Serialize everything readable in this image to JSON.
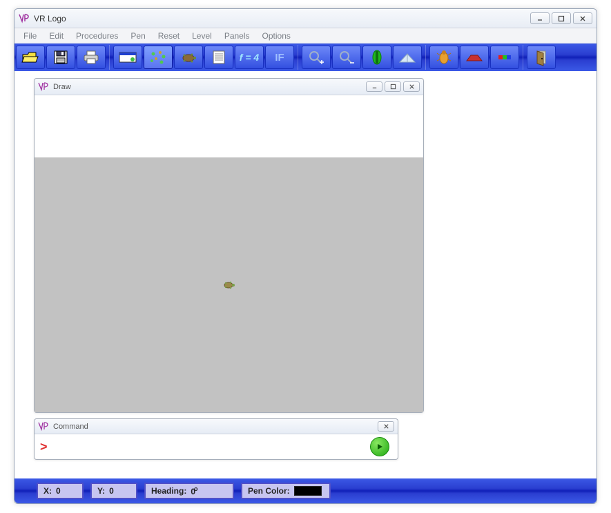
{
  "window": {
    "title": "VR Logo",
    "controls": {
      "min": "min",
      "max": "max",
      "close": "close"
    }
  },
  "menu": [
    "File",
    "Edit",
    "Procedures",
    "Pen",
    "Reset",
    "Level",
    "Panels",
    "Options"
  ],
  "toolbar": {
    "groups": [
      [
        "open",
        "save",
        "print"
      ],
      [
        "panel-blue",
        "panel-dots",
        "panel-turtle",
        "list",
        "var",
        "if"
      ],
      [
        "zoom-in",
        "zoom-out",
        "stoplight",
        "perspective"
      ],
      [
        "turtle-shape",
        "roof",
        "colors"
      ],
      [
        "exit"
      ]
    ],
    "var_label": "f = 4",
    "if_label": "IF"
  },
  "draw": {
    "title": "Draw"
  },
  "command": {
    "title": "Command",
    "prompt": ">",
    "value": ""
  },
  "status": {
    "x": {
      "label": "X:",
      "value": "0"
    },
    "y": {
      "label": "Y:",
      "value": "0"
    },
    "heading": {
      "label": "Heading:",
      "value": "0"
    },
    "pen": {
      "label": "Pen Color:",
      "color": "#000000"
    }
  }
}
